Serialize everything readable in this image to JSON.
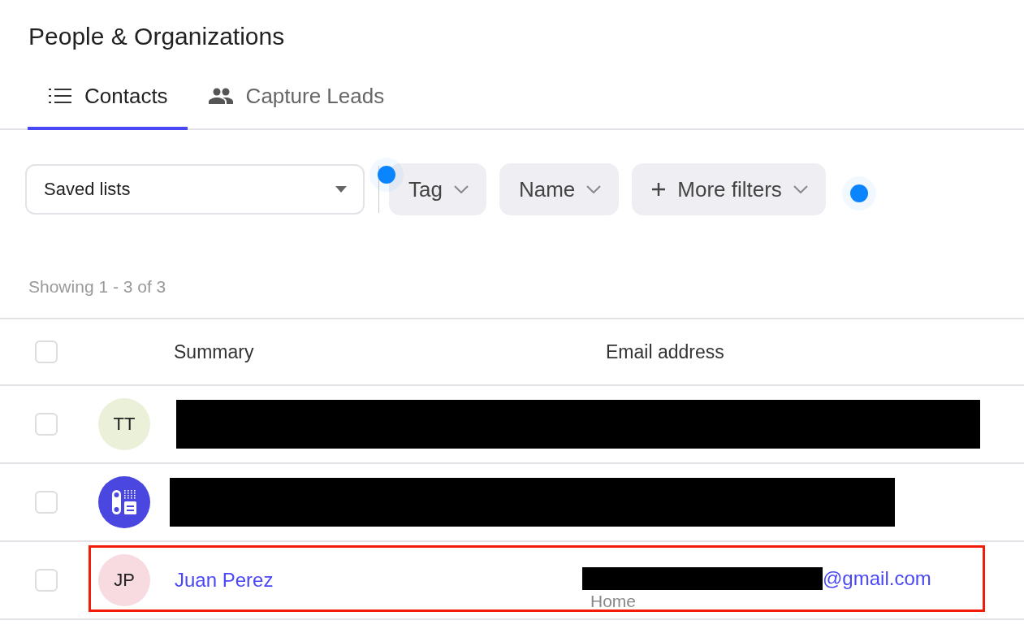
{
  "page": {
    "title": "People & Organizations"
  },
  "tabs": [
    {
      "label": "Contacts",
      "selected": true
    },
    {
      "label": "Capture Leads",
      "selected": false
    }
  ],
  "saved_lists": {
    "value": "Saved lists"
  },
  "filters": [
    {
      "label": "Tag",
      "kind": "dropdown"
    },
    {
      "label": "Name",
      "kind": "dropdown"
    },
    {
      "label": "More filters",
      "kind": "add"
    }
  ],
  "result_count": "Showing 1 - 3 of 3",
  "table": {
    "select_all_checked": false,
    "columns": [
      "Summary",
      "Email address"
    ],
    "rows": [
      {
        "kind": "initials",
        "initials": "TT",
        "color": "#ebf0d9",
        "redacted": true,
        "checked": false,
        "highlighted": false
      },
      {
        "kind": "device",
        "color": "#4a47e0",
        "redacted": true,
        "checked": false,
        "highlighted": false
      },
      {
        "kind": "initials",
        "initials": "JP",
        "color": "#f7dbe1",
        "redacted": false,
        "name": "Juan Perez",
        "email": "@gmail.com",
        "email_type": "Home",
        "checked": false,
        "highlighted": true
      }
    ]
  }
}
